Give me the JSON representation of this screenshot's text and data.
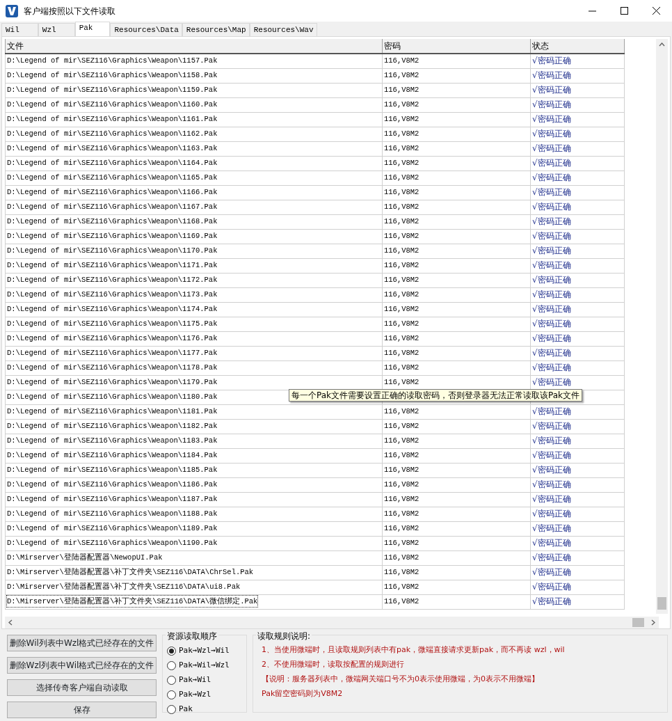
{
  "window": {
    "title": "客户端按照以下文件读取"
  },
  "tabs": [
    {
      "label": "Wil",
      "selected": false
    },
    {
      "label": "Wzl",
      "selected": false
    },
    {
      "label": "Pak",
      "selected": true
    },
    {
      "label": "Resources\\Data",
      "selected": false
    },
    {
      "label": "Resources\\Map",
      "selected": false
    },
    {
      "label": "Resources\\Wav",
      "selected": false
    }
  ],
  "table": {
    "columns": [
      "文件",
      "密码",
      "状态"
    ],
    "rows": [
      {
        "file": "D:\\Legend of mir\\SEZ116\\Graphics\\Weapon\\1157.Pak",
        "password": "116,V8M2",
        "status": "√密码正确",
        "selected": false
      },
      {
        "file": "D:\\Legend of mir\\SEZ116\\Graphics\\Weapon\\1158.Pak",
        "password": "116,V8M2",
        "status": "√密码正确",
        "selected": false
      },
      {
        "file": "D:\\Legend of mir\\SEZ116\\Graphics\\Weapon\\1159.Pak",
        "password": "116,V8M2",
        "status": "√密码正确",
        "selected": false
      },
      {
        "file": "D:\\Legend of mir\\SEZ116\\Graphics\\Weapon\\1160.Pak",
        "password": "116,V8M2",
        "status": "√密码正确",
        "selected": false
      },
      {
        "file": "D:\\Legend of mir\\SEZ116\\Graphics\\Weapon\\1161.Pak",
        "password": "116,V8M2",
        "status": "√密码正确",
        "selected": false
      },
      {
        "file": "D:\\Legend of mir\\SEZ116\\Graphics\\Weapon\\1162.Pak",
        "password": "116,V8M2",
        "status": "√密码正确",
        "selected": false
      },
      {
        "file": "D:\\Legend of mir\\SEZ116\\Graphics\\Weapon\\1163.Pak",
        "password": "116,V8M2",
        "status": "√密码正确",
        "selected": false
      },
      {
        "file": "D:\\Legend of mir\\SEZ116\\Graphics\\Weapon\\1164.Pak",
        "password": "116,V8M2",
        "status": "√密码正确",
        "selected": false
      },
      {
        "file": "D:\\Legend of mir\\SEZ116\\Graphics\\Weapon\\1165.Pak",
        "password": "116,V8M2",
        "status": "√密码正确",
        "selected": false
      },
      {
        "file": "D:\\Legend of mir\\SEZ116\\Graphics\\Weapon\\1166.Pak",
        "password": "116,V8M2",
        "status": "√密码正确",
        "selected": false
      },
      {
        "file": "D:\\Legend of mir\\SEZ116\\Graphics\\Weapon\\1167.Pak",
        "password": "116,V8M2",
        "status": "√密码正确",
        "selected": false
      },
      {
        "file": "D:\\Legend of mir\\SEZ116\\Graphics\\Weapon\\1168.Pak",
        "password": "116,V8M2",
        "status": "√密码正确",
        "selected": false
      },
      {
        "file": "D:\\Legend of mir\\SEZ116\\Graphics\\Weapon\\1169.Pak",
        "password": "116,V8M2",
        "status": "√密码正确",
        "selected": false
      },
      {
        "file": "D:\\Legend of mir\\SEZ116\\Graphics\\Weapon\\1170.Pak",
        "password": "116,V8M2",
        "status": "√密码正确",
        "selected": false
      },
      {
        "file": "D:\\Legend of mir\\SEZ116\\Graphics\\Weapon\\1171.Pak",
        "password": "116,V8M2",
        "status": "√密码正确",
        "selected": false
      },
      {
        "file": "D:\\Legend of mir\\SEZ116\\Graphics\\Weapon\\1172.Pak",
        "password": "116,V8M2",
        "status": "√密码正确",
        "selected": false
      },
      {
        "file": "D:\\Legend of mir\\SEZ116\\Graphics\\Weapon\\1173.Pak",
        "password": "116,V8M2",
        "status": "√密码正确",
        "selected": false
      },
      {
        "file": "D:\\Legend of mir\\SEZ116\\Graphics\\Weapon\\1174.Pak",
        "password": "116,V8M2",
        "status": "√密码正确",
        "selected": false
      },
      {
        "file": "D:\\Legend of mir\\SEZ116\\Graphics\\Weapon\\1175.Pak",
        "password": "116,V8M2",
        "status": "√密码正确",
        "selected": false
      },
      {
        "file": "D:\\Legend of mir\\SEZ116\\Graphics\\Weapon\\1176.Pak",
        "password": "116,V8M2",
        "status": "√密码正确",
        "selected": false
      },
      {
        "file": "D:\\Legend of mir\\SEZ116\\Graphics\\Weapon\\1177.Pak",
        "password": "116,V8M2",
        "status": "√密码正确",
        "selected": false
      },
      {
        "file": "D:\\Legend of mir\\SEZ116\\Graphics\\Weapon\\1178.Pak",
        "password": "116,V8M2",
        "status": "√密码正确",
        "selected": false
      },
      {
        "file": "D:\\Legend of mir\\SEZ116\\Graphics\\Weapon\\1179.Pak",
        "password": "116,V8M2",
        "status": "√密码正确",
        "selected": false
      },
      {
        "file": "D:\\Legend of mir\\SEZ116\\Graphics\\Weapon\\1180.Pak",
        "tooltip": "每一个Pak文件需要设置正确的读取密码，否则登录器无法正常读取该Pak文件",
        "selected": false
      },
      {
        "file": "D:\\Legend of mir\\SEZ116\\Graphics\\Weapon\\1181.Pak",
        "password": "116,V8M2",
        "status": "√密码正确",
        "selected": false
      },
      {
        "file": "D:\\Legend of mir\\SEZ116\\Graphics\\Weapon\\1182.Pak",
        "password": "116,V8M2",
        "status": "√密码正确",
        "selected": false
      },
      {
        "file": "D:\\Legend of mir\\SEZ116\\Graphics\\Weapon\\1183.Pak",
        "password": "116,V8M2",
        "status": "√密码正确",
        "selected": false
      },
      {
        "file": "D:\\Legend of mir\\SEZ116\\Graphics\\Weapon\\1184.Pak",
        "password": "116,V8M2",
        "status": "√密码正确",
        "selected": false
      },
      {
        "file": "D:\\Legend of mir\\SEZ116\\Graphics\\Weapon\\1185.Pak",
        "password": "116,V8M2",
        "status": "√密码正确",
        "selected": false
      },
      {
        "file": "D:\\Legend of mir\\SEZ116\\Graphics\\Weapon\\1186.Pak",
        "password": "116,V8M2",
        "status": "√密码正确",
        "selected": false
      },
      {
        "file": "D:\\Legend of mir\\SEZ116\\Graphics\\Weapon\\1187.Pak",
        "password": "116,V8M2",
        "status": "√密码正确",
        "selected": false
      },
      {
        "file": "D:\\Legend of mir\\SEZ116\\Graphics\\Weapon\\1188.Pak",
        "password": "116,V8M2",
        "status": "√密码正确",
        "selected": false
      },
      {
        "file": "D:\\Legend of mir\\SEZ116\\Graphics\\Weapon\\1189.Pak",
        "password": "116,V8M2",
        "status": "√密码正确",
        "selected": false
      },
      {
        "file": "D:\\Legend of mir\\SEZ116\\Graphics\\Weapon\\1190.Pak",
        "password": "116,V8M2",
        "status": "√密码正确",
        "selected": false
      },
      {
        "file": "D:\\Mirserver\\登陆器配置器\\NewopUI.Pak",
        "password": "116,V8M2",
        "status": "√密码正确",
        "selected": false
      },
      {
        "file": "D:\\Mirserver\\登陆器配置器\\补丁文件夹\\SEZ116\\DATA\\ChrSel.Pak",
        "password": "116,V8M2",
        "status": "√密码正确",
        "selected": false
      },
      {
        "file": "D:\\Mirserver\\登陆器配置器\\补丁文件夹\\SEZ116\\DATA\\ui8.Pak",
        "password": "116,V8M2",
        "status": "√密码正确",
        "selected": false
      },
      {
        "file": "D:\\Mirserver\\登陆器配置器\\补丁文件夹\\SEZ116\\DATA\\微信绑定.Pak",
        "password": "116,V8M2",
        "status": "√密码正确",
        "selected": true
      }
    ]
  },
  "buttons": [
    "删除Wil列表中Wzl格式已经存在的文件",
    "删除Wzl列表中Wil格式已经存在的文件",
    "选择传奇客户端自动读取",
    "保存"
  ],
  "read_order": {
    "title": "资源读取顺序",
    "options": [
      {
        "label": "Pak→Wzl→Wil",
        "selected": true
      },
      {
        "label": "Pak→Wil→Wzl",
        "selected": false
      },
      {
        "label": "Pak→Wil",
        "selected": false
      },
      {
        "label": "Pak→Wzl",
        "selected": false
      },
      {
        "label": "Pak",
        "selected": false
      }
    ]
  },
  "rules": {
    "title": "读取规则说明:",
    "lines": [
      "1、当使用微端时，且读取规则列表中有pak，微端直接请求更新pak，而不再读 wzl，wil",
      "2、不使用微端时，读取按配置的规则进行",
      "【说明：服务器列表中，微端网关端口号不为0表示使用微端，为0表示不用微端】",
      "Pak留空密码则为V8M2"
    ]
  }
}
